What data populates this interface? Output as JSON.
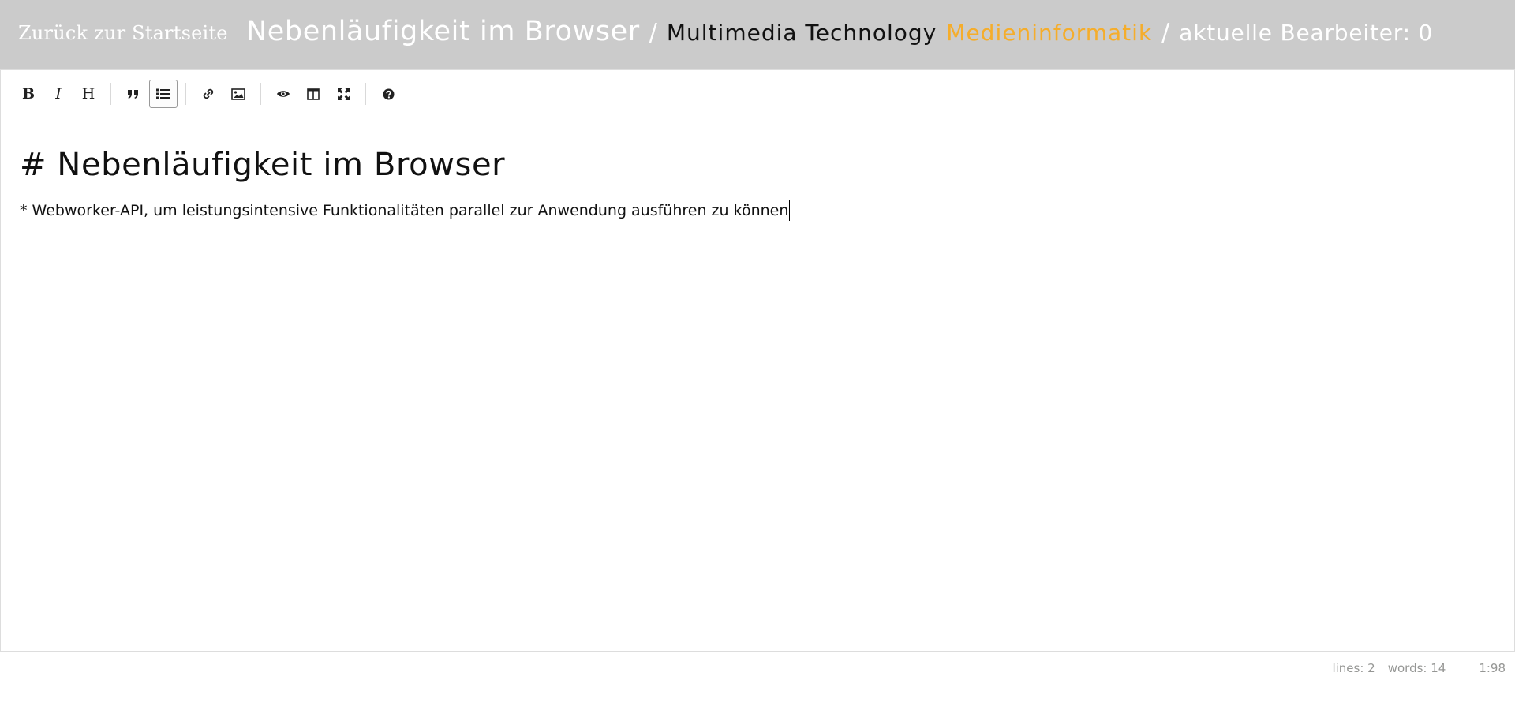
{
  "header": {
    "back_link": "Zurück zur Startseite",
    "doc_title": "Nebenläufigkeit im Browser",
    "separator": "/",
    "course": "Multimedia Technology",
    "category": "Medieninformatik",
    "editors_label": "aktuelle Bearbeiter: 0",
    "colors": {
      "background": "#cbcbcb",
      "category": "#f5ad2b"
    }
  },
  "toolbar": {
    "buttons": [
      {
        "name": "bold",
        "icon": "B"
      },
      {
        "name": "italic",
        "icon": "I"
      },
      {
        "name": "heading",
        "icon": "H"
      },
      {
        "name": "quote",
        "icon": "quote-icon"
      },
      {
        "name": "unordered-list",
        "icon": "list-icon",
        "active": true
      },
      {
        "name": "link",
        "icon": "link-icon"
      },
      {
        "name": "image",
        "icon": "image-icon"
      },
      {
        "name": "preview",
        "icon": "eye-icon"
      },
      {
        "name": "side-by-side",
        "icon": "columns-icon"
      },
      {
        "name": "fullscreen",
        "icon": "expand-icon"
      },
      {
        "name": "guide",
        "icon": "question-circle-icon"
      }
    ]
  },
  "editor": {
    "lines": [
      "# Nebenläufigkeit im Browser",
      "* Webworker-API, um leistungsintensive Funktionalitäten parallel zur Anwendung ausführen zu können"
    ]
  },
  "status": {
    "lines": "lines: 2",
    "words": "words: 14",
    "cursor": "1:98"
  }
}
